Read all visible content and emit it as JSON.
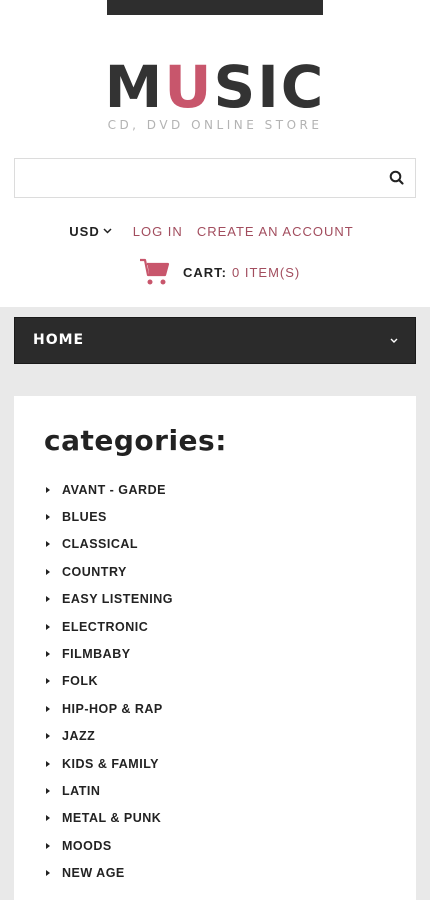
{
  "header": {
    "logo": {
      "part1": "M",
      "accent": "U",
      "part2": "SIC",
      "tagline": "CD, DVD ONLINE STORE"
    },
    "search": {
      "placeholder": "",
      "value": "",
      "icon": "search-icon"
    },
    "currency": "USD",
    "links": {
      "login": "LOG IN",
      "create_account": "CREATE AN ACCOUNT"
    },
    "cart": {
      "label": "CART:",
      "count": "0 ITEM(S)",
      "icon": "cart-icon"
    }
  },
  "nav": {
    "label": "HOME",
    "icon": "chevron-down-icon"
  },
  "categories": {
    "title": "categories:",
    "items": [
      "AVANT - GARDE",
      "BLUES",
      "CLASSICAL",
      "COUNTRY",
      "EASY LISTENING",
      "ELECTRONIC",
      "FILMBABY",
      "FOLK",
      "HIP-HOP & RAP",
      "JAZZ",
      "KIDS & FAMILY",
      "LATIN",
      "METAL & PUNK",
      "MOODS",
      "NEW AGE"
    ]
  },
  "colors": {
    "accent": "#c8566c",
    "link": "#a24d5e",
    "dark": "#2b2b2b",
    "background": "#e9e9e9"
  }
}
